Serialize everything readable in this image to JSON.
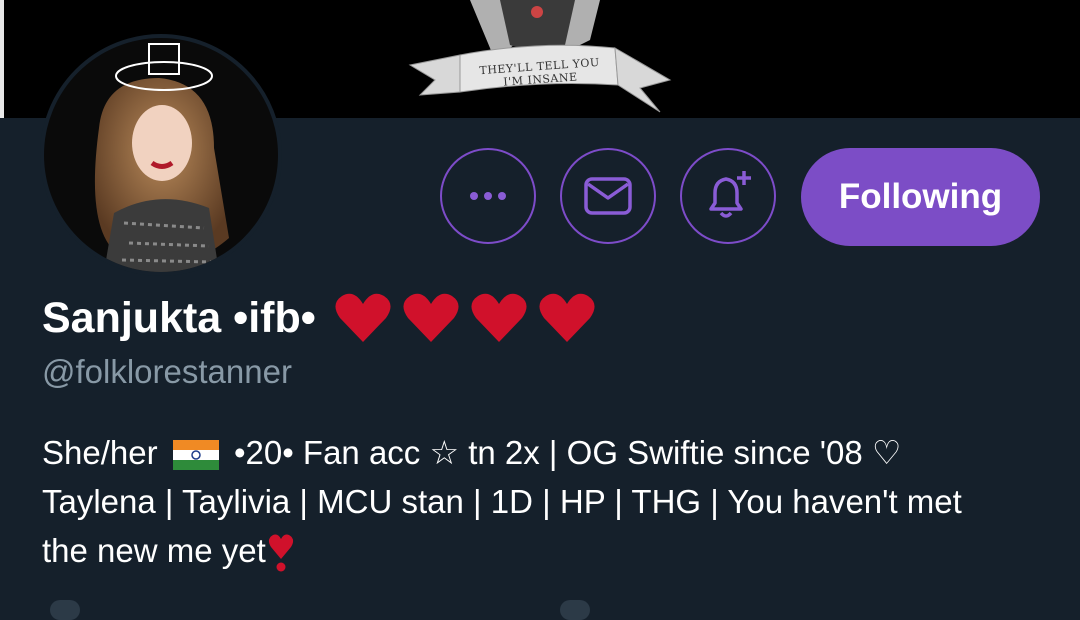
{
  "banner": {
    "caption": "THEY'LL TELL YOU I'M INSANE"
  },
  "profile": {
    "display_name": "Sanjukta •ifb•",
    "handle": "@folklorestanner",
    "heart_count": 4
  },
  "actions": {
    "follow_label": "Following",
    "more_icon": "more-horizontal-icon",
    "dm_icon": "envelope-icon",
    "notify_icon": "bell-plus-icon"
  },
  "bio": {
    "line1_a": "She/her",
    "line1_b": "•20• Fan acc ☆ tn 2x | OG Swiftie since '08 ♡",
    "line2": "Taylena | Taylivia | MCU stan | 1D | HP | THG | You haven't met",
    "line3": "the new me yet"
  },
  "colors": {
    "background": "#15202b",
    "accent": "#7c4dc6",
    "muted_text": "#8899a6",
    "heart": "#d0112b"
  }
}
